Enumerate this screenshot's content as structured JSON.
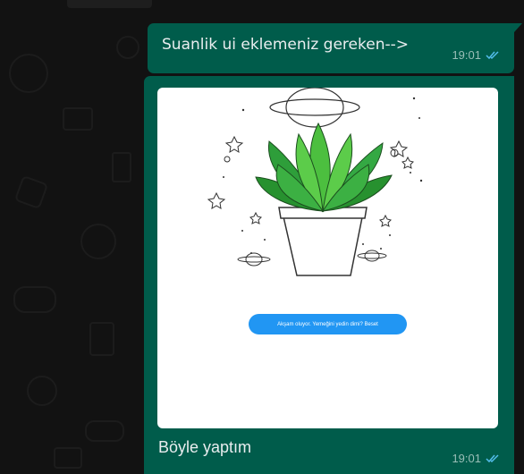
{
  "chat": {
    "messages": [
      {
        "text": "Suanlik ui eklemeniz gereken-->",
        "time": "19:01",
        "status_icon": "double-check-icon"
      },
      {
        "image": {
          "description_icon": "plant-illustration",
          "toast_text": "Akşam oluyor. Yemeğini yedin dimi? Beset"
        },
        "text": "Böyle yaptım",
        "time": "19:01",
        "status_icon": "double-check-icon"
      }
    ]
  },
  "colors": {
    "wallpaper": "#121212",
    "outgoing_bubble": "#005c4b",
    "message_text": "#e9edef",
    "meta_text": "#99beb7",
    "read_ticks": "#53bdeb",
    "toast": "#2196f3"
  }
}
